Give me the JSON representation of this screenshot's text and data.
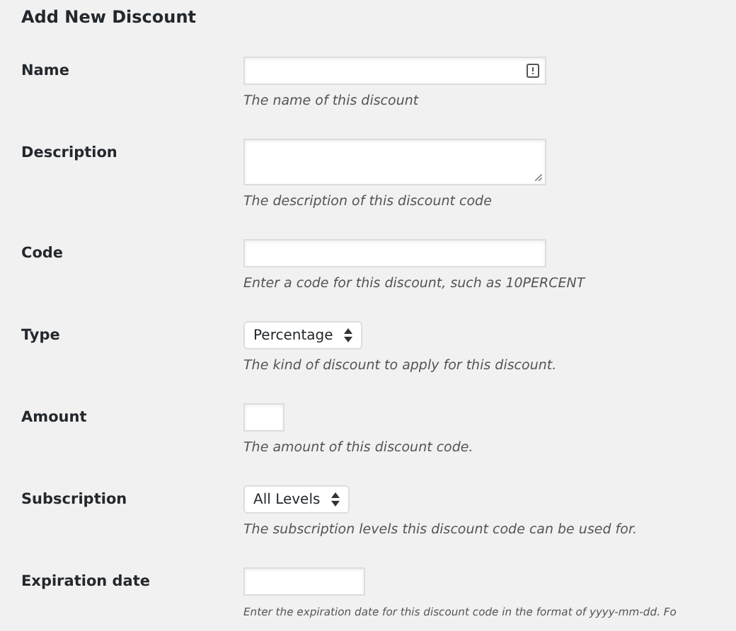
{
  "title": "Add New Discount",
  "fields": [
    {
      "label": "Name",
      "kind": "text",
      "has_icon": true,
      "description": "The name of this discount"
    },
    {
      "label": "Description",
      "kind": "textarea",
      "description": "The description of this discount code"
    },
    {
      "label": "Code",
      "kind": "text",
      "description": "Enter a code for this discount, such as 10PERCENT"
    },
    {
      "label": "Type",
      "kind": "select",
      "value": "Percentage",
      "description": "The kind of discount to apply for this discount."
    },
    {
      "label": "Amount",
      "kind": "tiny",
      "description": "The amount of this discount code."
    },
    {
      "label": "Subscription",
      "kind": "select",
      "value": "All Levels",
      "description": "The subscription levels this discount code can be used for."
    },
    {
      "label": "Expiration date",
      "kind": "short",
      "description": "Enter the expiration date for this discount code in the format of yyyy-mm-dd. Fo"
    }
  ]
}
